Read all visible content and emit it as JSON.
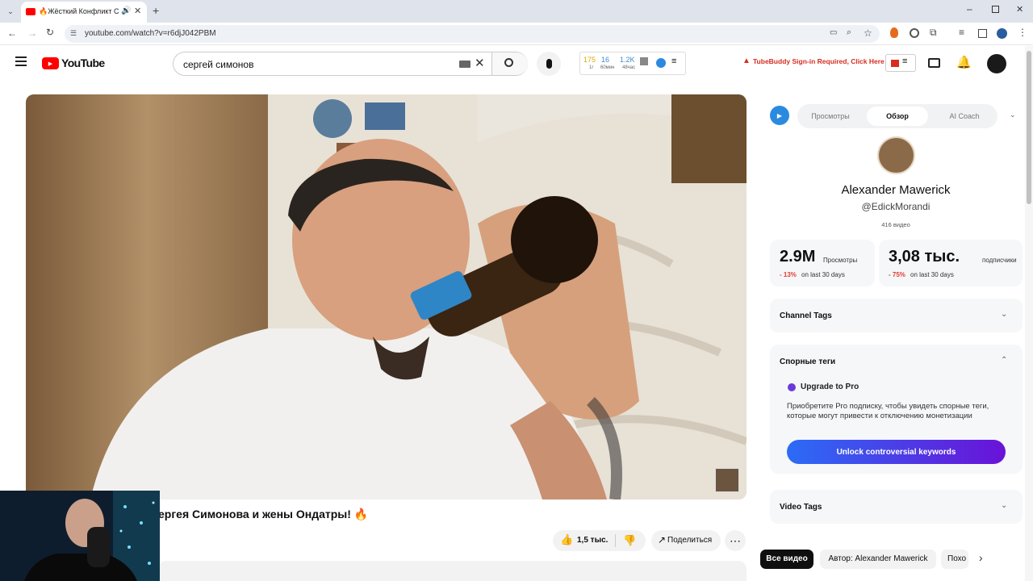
{
  "browser": {
    "tab_title": "🔥Жёсткий Конфликт Сер",
    "url": "youtube.com/watch?v=r6djJ042PBM"
  },
  "youtube": {
    "logo_text": "YouTube",
    "search_query": "сергей симонов",
    "stats_widget": {
      "v1": "175",
      "l1": "1г",
      "v2": "16",
      "l2": "60мин",
      "v3": "1.2K",
      "l3": "48час"
    },
    "tubebuddy_warning": "TubeBuddy Sign-in Required, Click Here"
  },
  "video": {
    "title_visible": "ергея Симонова и жены Ондатры! 🔥",
    "like_count": "1,5 тыс.",
    "share_label": "Поделиться"
  },
  "tubebuddy": {
    "tabs": [
      "Просмотры",
      "Обзор",
      "AI Coach"
    ],
    "active_tab": "Обзор",
    "channel_name": "Alexander Mawerick",
    "channel_handle": "@EdickMorandi",
    "video_count": "416 видео",
    "stats": [
      {
        "value": "2.9M",
        "label": "Просмотры",
        "change": "- 13%",
        "period": "on last 30 days"
      },
      {
        "value": "3,08 тыс.",
        "label": "подписчики",
        "change": "- 75%",
        "period": "on last 30 days"
      }
    ],
    "sections": {
      "channel_tags": "Channel Tags",
      "controversial": "Спорные теги",
      "video_tags": "Video Tags"
    },
    "upgrade_title": "Upgrade to Pro",
    "upgrade_text": "Приобретите Pro подписку, чтобы увидеть спорные теги, которые могут привести к отключению монетизации",
    "unlock_button": "Unlock controversial keywords"
  },
  "chips": [
    "Все видео",
    "Автор: Alexander Mawerick",
    "Похо"
  ],
  "colors": {
    "youtube_red": "#ff0000",
    "unlock_gradient_start": "#2b6cf6",
    "unlock_gradient_end": "#6a12d8",
    "negative": "#e23a2e",
    "warning": "#d62d20"
  }
}
